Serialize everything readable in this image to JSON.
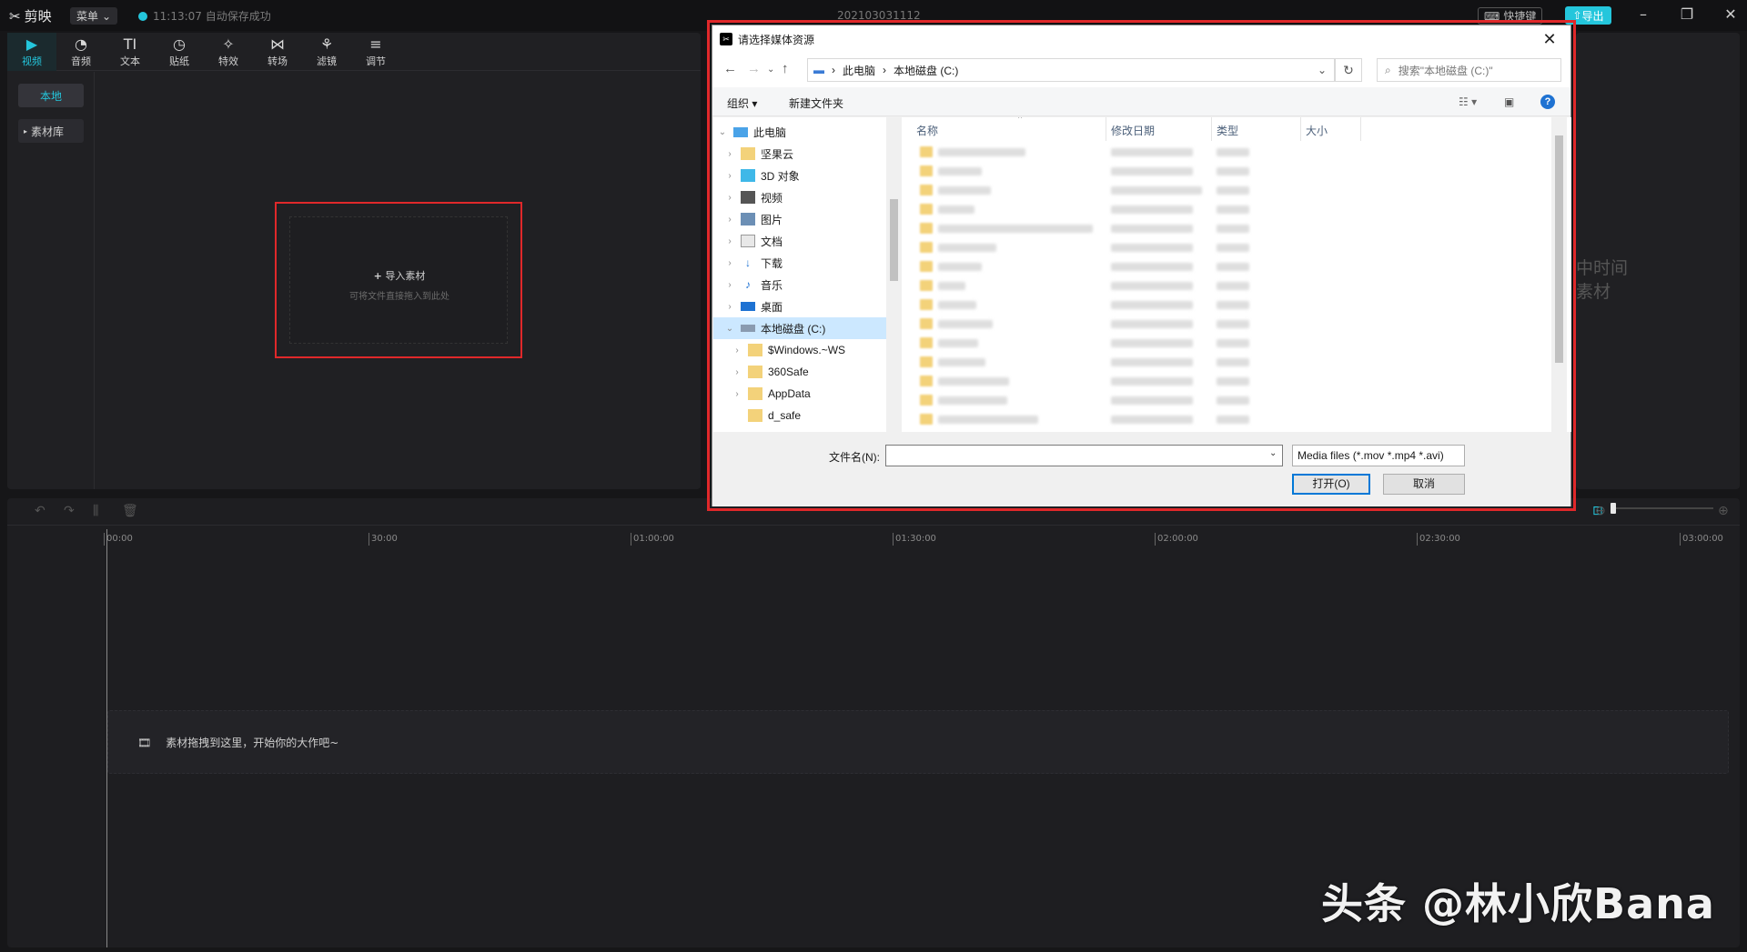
{
  "app": {
    "name": "剪映",
    "menu_label": "菜单",
    "save_status": "11:13:07 自动保存成功",
    "project_title": "202103031112",
    "hotkey_label": "快捷键",
    "export_label": "导出",
    "colors": {
      "accent": "#24c6dc",
      "highlight_box": "#e0282a",
      "background": "#161618"
    }
  },
  "toolbar": {
    "items": [
      {
        "label": "视频",
        "icon": "video-icon",
        "glyph": "▶"
      },
      {
        "label": "音频",
        "icon": "audio-icon",
        "glyph": "◔"
      },
      {
        "label": "文本",
        "icon": "text-icon",
        "glyph": "TI"
      },
      {
        "label": "贴纸",
        "icon": "sticker-icon",
        "glyph": "◷"
      },
      {
        "label": "特效",
        "icon": "effects-icon",
        "glyph": "✧"
      },
      {
        "label": "转场",
        "icon": "transition-icon",
        "glyph": "⋈"
      },
      {
        "label": "滤镜",
        "icon": "filter-icon",
        "glyph": "⚘"
      },
      {
        "label": "调节",
        "icon": "adjust-icon",
        "glyph": "≡"
      }
    ]
  },
  "sidebar": {
    "local": "本地",
    "library": "素材库"
  },
  "import": {
    "label": "导入素材",
    "sub": "可将文件直接拖入到此处"
  },
  "right_panel": {
    "hint_line1": "中时间",
    "hint_line2": "素材"
  },
  "timeline": {
    "ticks": [
      "00:00",
      "30:00",
      "01:00:00",
      "01:30:00",
      "02:00:00",
      "02:30:00",
      "03:00:00"
    ],
    "track_hint": "素材拖拽到这里，开始你的大作吧~"
  },
  "watermark": "头条 @林小欣Bana",
  "dialog": {
    "title": "请选择媒体资源",
    "close": "✕",
    "path": [
      "此电脑",
      "本地磁盘 (C:)"
    ],
    "search_placeholder": "搜索\"本地磁盘 (C:)\"",
    "organize": "组织 ▾",
    "new_folder": "新建文件夹",
    "tree": [
      {
        "label": "此电脑",
        "indent": 0,
        "chev": "v",
        "icon": "pc-icon"
      },
      {
        "label": "坚果云",
        "indent": 1,
        "chev": ">",
        "icon": "folder-icon"
      },
      {
        "label": "3D 对象",
        "indent": 1,
        "chev": ">",
        "icon": "3d-objects-icon"
      },
      {
        "label": "视频",
        "indent": 1,
        "chev": ">",
        "icon": "videos-icon"
      },
      {
        "label": "图片",
        "indent": 1,
        "chev": ">",
        "icon": "pictures-icon"
      },
      {
        "label": "文档",
        "indent": 1,
        "chev": ">",
        "icon": "documents-icon"
      },
      {
        "label": "下载",
        "indent": 1,
        "chev": ">",
        "icon": "downloads-icon"
      },
      {
        "label": "音乐",
        "indent": 1,
        "chev": ">",
        "icon": "music-icon"
      },
      {
        "label": "桌面",
        "indent": 1,
        "chev": ">",
        "icon": "desktop-icon"
      },
      {
        "label": "本地磁盘 (C:)",
        "indent": 1,
        "chev": "v",
        "icon": "drive-icon",
        "selected": true
      },
      {
        "label": "$Windows.~WS",
        "indent": 2,
        "chev": ">",
        "icon": "folder-icon"
      },
      {
        "label": "360Safe",
        "indent": 2,
        "chev": ">",
        "icon": "folder-icon"
      },
      {
        "label": "AppData",
        "indent": 2,
        "chev": ">",
        "icon": "folder-icon"
      },
      {
        "label": "d_safe",
        "indent": 2,
        "chev": "",
        "icon": "folder-icon"
      }
    ],
    "columns": [
      "名称",
      "修改日期",
      "类型",
      "大小"
    ],
    "file_name_label": "文件名(N):",
    "file_name_value": "",
    "filter": "Media files (*.mov *.mp4 *.avi)",
    "open": "打开(O)",
    "cancel": "取消"
  }
}
